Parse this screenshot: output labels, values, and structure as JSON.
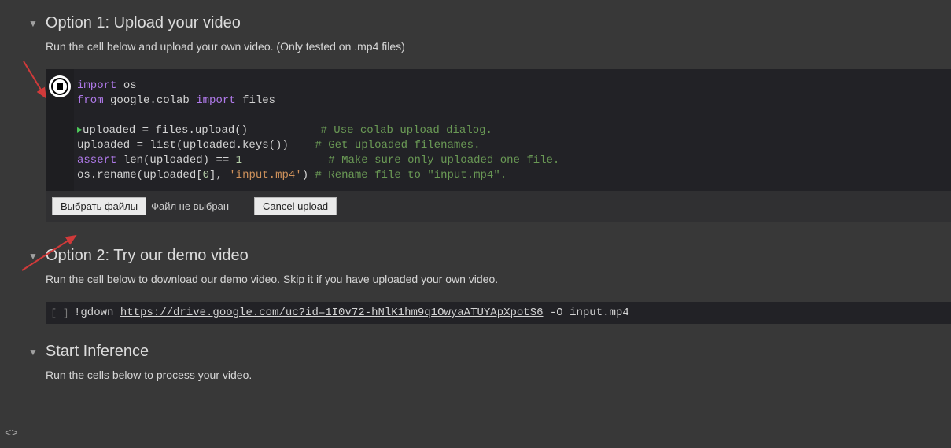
{
  "sections": [
    {
      "title": "Option 1: Upload your video",
      "desc": "Run the cell below and upload your own video. (Only tested on .mp4 files)"
    },
    {
      "title": "Option 2: Try our demo video",
      "desc": "Run the cell below to download our demo video. Skip it if you have uploaded your own video."
    },
    {
      "title": "Start Inference",
      "desc": "Run the cells below to process your video."
    }
  ],
  "code1": {
    "l1_kw": "import",
    "l1_id": " os",
    "l2_kw1": "from",
    "l2_id": " google.colab ",
    "l2_kw2": "import",
    "l2_id2": " files",
    "l3_var": "uploaded = files.upload()",
    "l3_cm": "# Use colab upload dialog.",
    "l4_code": "uploaded = list(uploaded.keys())",
    "l4_cm": "# Get uploaded filenames.",
    "l5_kw": "assert",
    "l5_code": " len(uploaded) == ",
    "l5_num": "1",
    "l5_cm": "# Make sure only uploaded one file.",
    "l6_code1": "os.rename(uploaded[",
    "l6_num": "0",
    "l6_code2": "], ",
    "l6_str": "'input.mp4'",
    "l6_code3": ") ",
    "l6_cm": "# Rename file to \"input.mp4\"."
  },
  "upload": {
    "choose_label": "Выбрать файлы",
    "status": "Файл не выбран",
    "cancel_label": "Cancel upload"
  },
  "code2": {
    "cmd_prefix": "!gdown ",
    "url": "https://drive.google.com/uc?id=1I0v72-hNlK1hm9q1OwyaATUYApXpotS6",
    "cmd_suffix": " -O input.mp4"
  },
  "brackets": "[ ]",
  "footer": "<>"
}
